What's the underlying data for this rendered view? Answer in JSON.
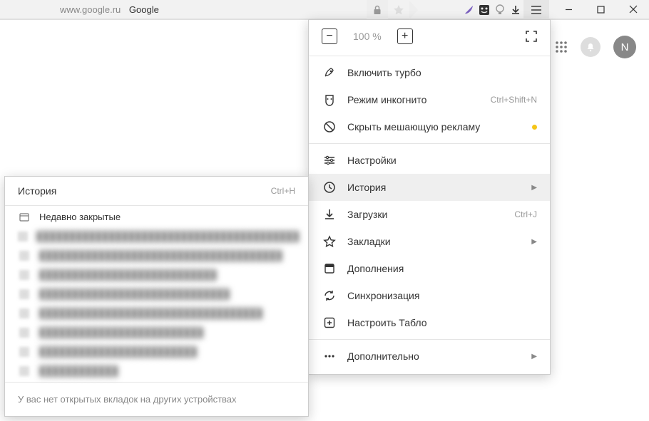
{
  "address": {
    "url": "www.google.ru",
    "title": "Google"
  },
  "zoom": {
    "value": "100 %"
  },
  "menu": {
    "turbo": "Включить турбо",
    "incognito": "Режим инкогнито",
    "incognito_shortcut": "Ctrl+Shift+N",
    "hide_ads": "Скрыть мешающую рекламу",
    "settings": "Настройки",
    "history": "История",
    "downloads": "Загрузки",
    "downloads_shortcut": "Ctrl+J",
    "bookmarks": "Закладки",
    "addons": "Дополнения",
    "sync": "Синхронизация",
    "tablo": "Настроить Табло",
    "more": "Дополнительно"
  },
  "history_panel": {
    "title": "История",
    "shortcut": "Ctrl+H",
    "recently_closed": "Недавно закрытые",
    "footer": "У вас нет открытых вкладок на других устройствах"
  },
  "avatar": {
    "initial": "N"
  }
}
